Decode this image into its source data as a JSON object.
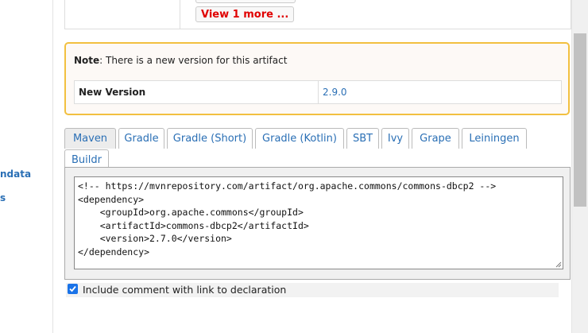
{
  "sidebar": {
    "items": [
      {
        "label": "ndata"
      },
      {
        "label": "s"
      }
    ]
  },
  "artifact_table": {
    "view_more_label": "View 1 more ..."
  },
  "note": {
    "prefix": "Note",
    "text": ": There is a new version for this artifact",
    "new_version_label": "New Version",
    "new_version_value": "2.9.0"
  },
  "build_tabs": {
    "selected": "Maven",
    "items": [
      {
        "label": "Maven"
      },
      {
        "label": "Gradle"
      },
      {
        "label": "Gradle (Short)"
      },
      {
        "label": "Gradle (Kotlin)"
      },
      {
        "label": "SBT"
      },
      {
        "label": "Ivy"
      },
      {
        "label": "Grape"
      },
      {
        "label": "Leiningen"
      },
      {
        "label": "Buildr"
      }
    ]
  },
  "snippet": {
    "code": "<!-- https://mvnrepository.com/artifact/org.apache.commons/commons-dbcp2 -->\n<dependency>\n    <groupId>org.apache.commons</groupId>\n    <artifactId>commons-dbcp2</artifactId>\n    <version>2.7.0</version>\n</dependency>"
  },
  "options": {
    "include_comment_label": "Include comment with link to declaration",
    "include_comment_checked": true
  },
  "colors": {
    "link": "#2a6fb5",
    "note_border": "#f2c040",
    "view_more": "#e00000",
    "checkbox": "#1a73e8"
  }
}
